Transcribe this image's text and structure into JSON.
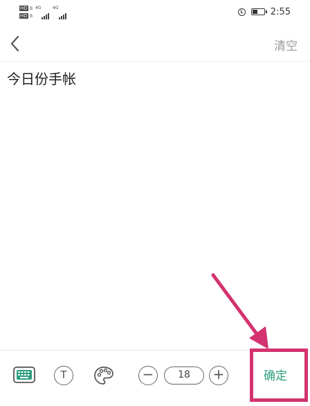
{
  "status": {
    "hd_label": "HD",
    "hd_sub": "B",
    "network_label": "4G",
    "time": "2:55"
  },
  "nav": {
    "clear_label": "清空"
  },
  "editor": {
    "content": "今日份手帐"
  },
  "toolbar": {
    "font_size": "18",
    "text_tool_glyph": "T",
    "minus_glyph": "−",
    "plus_glyph": "+",
    "confirm_label": "确定"
  },
  "colors": {
    "accent_green": "#2e9e7f",
    "annotation_pink": "#d3336f"
  }
}
